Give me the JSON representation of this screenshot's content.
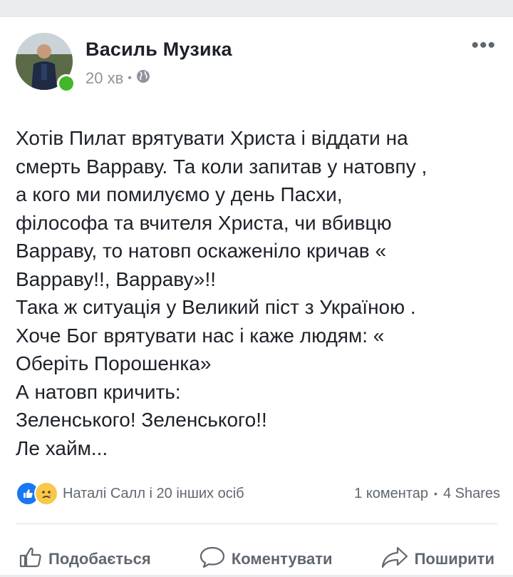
{
  "post": {
    "author": "Василь Музика",
    "time": "20 хв",
    "separator": "•",
    "privacy_icon": "globe-icon",
    "more_icon": "more-options-icon",
    "more_label": "•••",
    "lines": [
      "Хотів Пилат врятувати Христа і віддати на",
      "смерть Варраву. Та коли запитав у натовпу ,",
      "а кого ми помилуємо у день Пасхи,",
      "філософа та вчителя Христа, чи вбивцю",
      "Варраву, то натовп оскаженіло кричав «",
      "Варраву!!, Варраву»!!",
      "Така ж ситуація у Великий піст з Україною .",
      "Хоче Бог врятувати нас і каже людям: «",
      "Оберіть Порошенка»",
      "А натовп кричить:",
      "Зеленського! Зеленського!!",
      "Ле хайм..."
    ]
  },
  "reactions": {
    "icons": [
      "like-reaction-icon",
      "sad-reaction-icon"
    ],
    "text": "Наталі Салл і 20 інших осіб",
    "comments": "1 коментар",
    "separator": "•",
    "shares": "4 Shares"
  },
  "actions": {
    "like": "Подобається",
    "comment": "Коментувати",
    "share": "Поширити"
  },
  "colors": {
    "online": "#42b72a",
    "like_blue": "#1877f2",
    "sad_yellow": "#f7c84a",
    "muted": "#606770"
  }
}
